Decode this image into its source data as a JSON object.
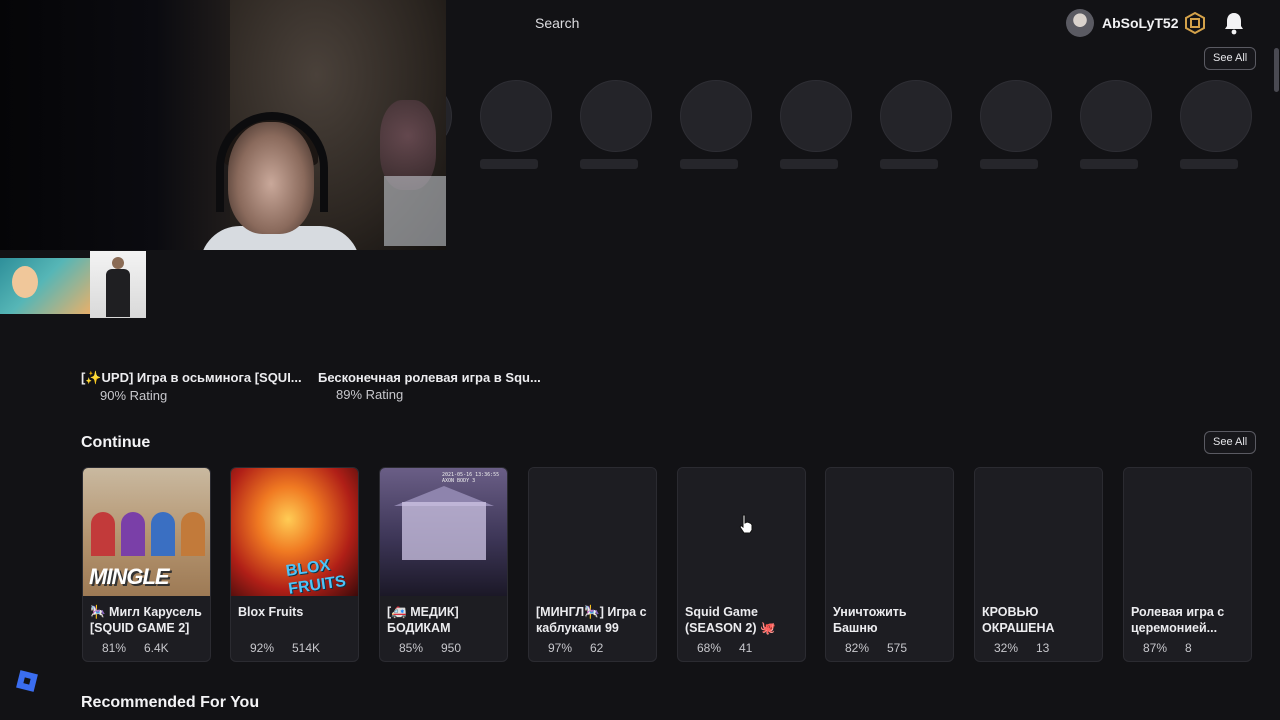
{
  "header": {
    "search_label": "Search",
    "username": "AbSoLyT52",
    "see_all_top": "See All"
  },
  "upper_games": [
    {
      "name": "[✨UPD] Игра в осьминога [SQUI...",
      "rating": "90% Rating"
    },
    {
      "name": "Бесконечная ролевая игра в Squ...",
      "rating": "89% Rating"
    }
  ],
  "continue": {
    "title": "Continue",
    "see_all": "See All",
    "cards": [
      {
        "title": "🎠 Мигл Карусель [SQUID GAME 2]",
        "rating": "81%",
        "players": "6.4K",
        "thumb_text": "MINGLE"
      },
      {
        "title": "Blox Fruits",
        "rating": "92%",
        "players": "514K",
        "thumb_text": "BLOX FRUITS"
      },
      {
        "title": "[🚑 МЕДИК] БОДИКАМ",
        "rating": "85%",
        "players": "950",
        "thumb_text": "2021-05-16 13:36:55 AXON BODY 3"
      },
      {
        "title": "[МИНГЛ🎠] Игра с каблуками 99",
        "rating": "97%",
        "players": "62"
      },
      {
        "title": "Squid Game (SEASON 2) 🐙",
        "rating": "68%",
        "players": "41"
      },
      {
        "title": "Уничтожить Башню",
        "rating": "82%",
        "players": "575"
      },
      {
        "title": "КРОВЬЮ ОКРАШЕНА",
        "rating": "32%",
        "players": "13"
      },
      {
        "title": "Ролевая игра с церемонией...",
        "rating": "87%",
        "players": "8"
      }
    ]
  },
  "recommended": {
    "title": "Recommended For You"
  },
  "colors": {
    "background": "#121215",
    "card": "#1d1d22",
    "logo": "#3a6df0"
  }
}
